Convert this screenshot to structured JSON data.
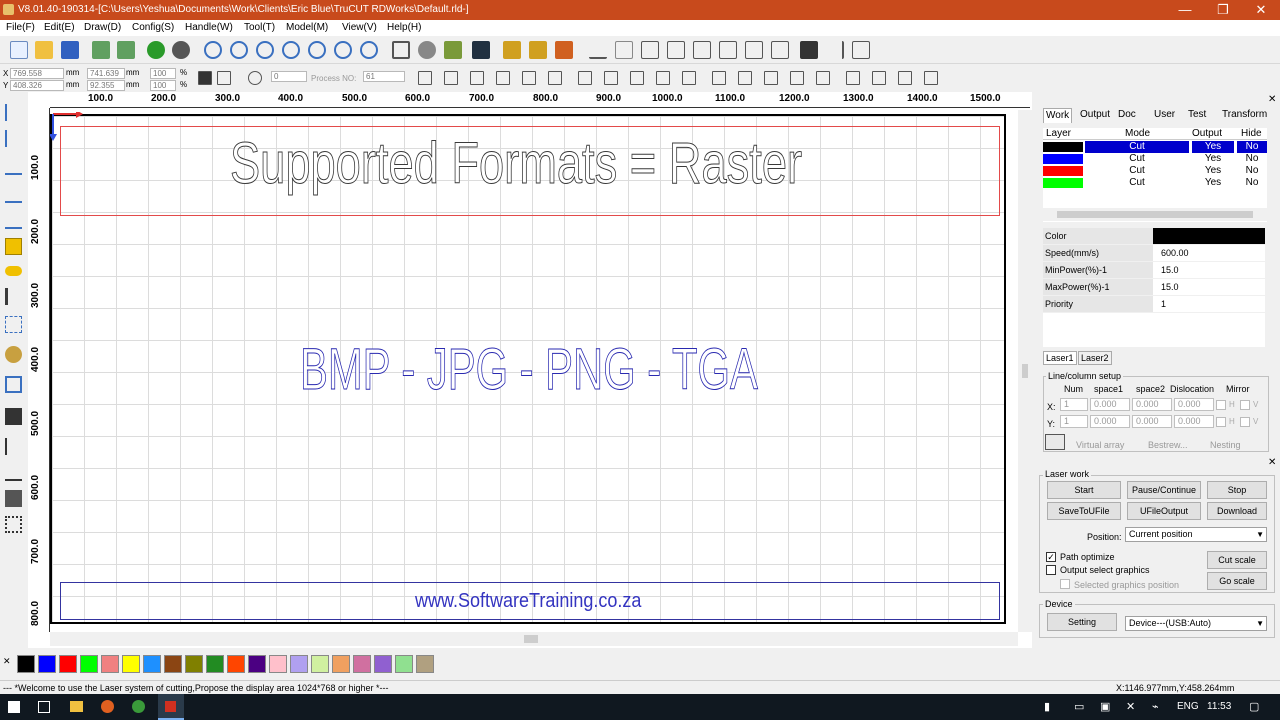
{
  "window": {
    "title": "V8.01.40-190314-[C:\\Users\\Yeshua\\Documents\\Work\\Clients\\Eric Blue\\TruCUT RDWorks\\Default.rld-]",
    "minimize": "—",
    "maximize": "❐",
    "close": "✕"
  },
  "menu": [
    "File(F)",
    "Edit(E)",
    "Draw(D)",
    "Config(S)",
    "Handle(W)",
    "Tool(T)",
    "Model(M)",
    "View(V)",
    "Help(H)"
  ],
  "toolbar2": {
    "x_pos": "769.558",
    "y_pos": "408.326",
    "unit_x": "mm",
    "unit_y": "mm",
    "width_val": "741.639",
    "height_val": "92.355",
    "unit_w": "mm",
    "unit_h": "mm",
    "scale_x": "100",
    "scale_y": "100",
    "pct_x": "%",
    "pct_y": "%",
    "rotate_val": "0",
    "process_label": "Process NO:",
    "process_val": "61",
    "x_label": "X",
    "y_label": "Y"
  },
  "ruler": {
    "h_ticks": [
      "100.0",
      "200.0",
      "300.0",
      "400.0",
      "500.0",
      "600.0",
      "700.0",
      "800.0",
      "900.0",
      "1000.0",
      "1100.0",
      "1200.0",
      "1300.0",
      "1400.0",
      "1500.0"
    ],
    "v_ticks": [
      "100.0",
      "200.0",
      "300.0",
      "400.0",
      "500.0",
      "600.0",
      "700.0",
      "800.0"
    ]
  },
  "canvas": {
    "heading": "Supported Formats = Raster",
    "formats": "BMP - JPG - PNG - TGA",
    "website": "www.SoftwareTraining.co.za"
  },
  "panel": {
    "tabs": [
      "Work",
      "Output",
      "Doc",
      "User",
      "Test",
      "Transform"
    ],
    "layer_headers": {
      "layer": "Layer",
      "mode": "Mode",
      "output": "Output",
      "hide": "Hide"
    },
    "layers": [
      {
        "color": "#000000",
        "mode": "Cut",
        "output": "Yes",
        "hide": "No"
      },
      {
        "color": "#0000ff",
        "mode": "Cut",
        "output": "Yes",
        "hide": "No"
      },
      {
        "color": "#ff0000",
        "mode": "Cut",
        "output": "Yes",
        "hide": "No"
      },
      {
        "color": "#00ff00",
        "mode": "Cut",
        "output": "Yes",
        "hide": "No"
      }
    ],
    "props": [
      {
        "key": "Color",
        "value": ""
      },
      {
        "key": "Speed(mm/s)",
        "value": "600.00"
      },
      {
        "key": "MinPower(%)-1",
        "value": "15.0"
      },
      {
        "key": "MaxPower(%)-1",
        "value": "15.0"
      },
      {
        "key": "Priority",
        "value": "1"
      }
    ],
    "laser_tabs": [
      "Laser1",
      "Laser2"
    ],
    "array": {
      "group_label": "Line/column setup",
      "headers": [
        "Num",
        "space1",
        "space2",
        "Dislocation",
        "Mirror"
      ],
      "x_label": "X:",
      "y_label": "Y:",
      "x_values": [
        "1",
        "0.000",
        "0.000",
        "0.000"
      ],
      "y_values": [
        "1",
        "0.000",
        "0.000",
        "0.000"
      ],
      "h": "H",
      "v": "V",
      "virtual_array": "Virtual array",
      "bestrew": "Bestrew...",
      "nesting": "Nesting"
    },
    "laserwork": {
      "group_label": "Laser work",
      "start": "Start",
      "pause": "Pause/Continue",
      "stop": "Stop",
      "save_file": "SaveToUFile",
      "ufile_output": "UFileOutput",
      "download": "Download",
      "position_label": "Position:",
      "position_value": "Current position",
      "path_optimize": "Path optimize",
      "output_select": "Output select graphics",
      "selected_pos": "Selected graphics position",
      "cut_scale": "Cut scale",
      "go_scale": "Go scale"
    },
    "device": {
      "group_label": "Device",
      "setting": "Setting",
      "device_value": "Device---(USB:Auto)"
    }
  },
  "palette": [
    "#000000",
    "#0000ff",
    "#ff0000",
    "#00ff00",
    "#f08080",
    "#ffff00",
    "#1e90ff",
    "#8b4513",
    "#808000",
    "#228b22",
    "#ff4500",
    "#4b0082",
    "#ffc0cb",
    "#b0a0f0",
    "#d0f0a0",
    "#f0a060",
    "#d070a0",
    "#9060d0",
    "#90e090",
    "#b0a080"
  ],
  "status": {
    "message": "--- *Welcome to use the Laser system of cutting,Propose the display area 1024*768 or higher *---",
    "coords": "X:1146.977mm,Y:458.264mm"
  },
  "taskbar": {
    "lang": "ENG",
    "time": "11:53"
  }
}
